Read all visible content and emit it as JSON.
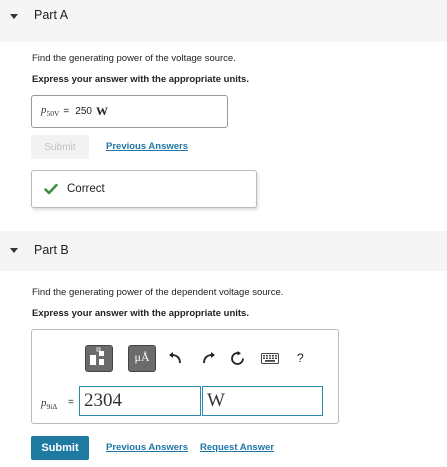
{
  "part_a": {
    "title": "Part A",
    "question": "Find the generating power of the voltage source.",
    "instruction": "Express your answer with the appropriate units.",
    "answer_var": "p",
    "answer_var_sub": "50V",
    "answer_eq": "=",
    "answer_value": "250",
    "answer_unit": "W",
    "submit_label": "Submit",
    "previous_answers_label": "Previous Answers",
    "feedback": "Correct",
    "feedback_color": "#3a8c3a"
  },
  "part_b": {
    "title": "Part B",
    "question": "Find the generating power of the dependent voltage source.",
    "instruction": "Express your answer with the appropriate units.",
    "answer_var": "p",
    "answer_var_sub": "9i",
    "answer_var_sub2": "Δ",
    "answer_eq": "=",
    "value": "2304",
    "unit": "W",
    "units_tool_label": "μÅ",
    "help_label": "?",
    "submit_label": "Submit",
    "previous_answers_label": "Previous Answers",
    "request_answer_label": "Request Answer",
    "accent_color": "#1e7aa0"
  }
}
